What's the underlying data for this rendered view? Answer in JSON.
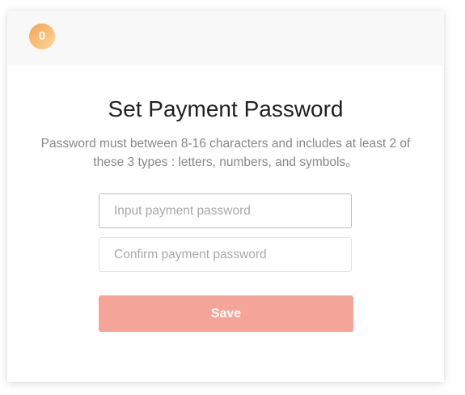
{
  "header": {
    "avatar_initial": "0"
  },
  "main": {
    "title": "Set Payment Password",
    "description": "Password must between 8-16 characters and includes at least 2 of these 3 types : letters, numbers, and symbols。",
    "password_field": {
      "placeholder": "Input payment password",
      "value": ""
    },
    "confirm_field": {
      "placeholder": "Confirm payment password",
      "value": ""
    },
    "save_label": "Save"
  },
  "colors": {
    "avatar_gradient_start": "#f6a352",
    "avatar_gradient_end": "#ffd59a",
    "save_button": "#f5a597",
    "header_background": "#f8f8f8",
    "title_text": "#222222",
    "description_text": "#888888"
  }
}
